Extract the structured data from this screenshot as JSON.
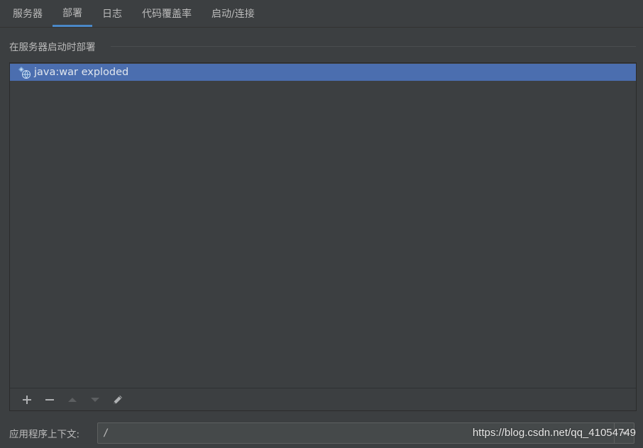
{
  "tabs": [
    {
      "label": "服务器",
      "active": false
    },
    {
      "label": "部署",
      "active": true
    },
    {
      "label": "日志",
      "active": false
    },
    {
      "label": "代码覆盖率",
      "active": false
    },
    {
      "label": "启动/连接",
      "active": false
    }
  ],
  "deploy_section": {
    "title": "在服务器启动时部署",
    "items": [
      {
        "label": "java:war exploded",
        "icon": "artifact-war-icon",
        "selected": true
      }
    ],
    "toolbar": {
      "add": "add-icon",
      "remove": "remove-icon",
      "move_up": "arrow-up-icon",
      "move_down": "arrow-down-icon",
      "edit": "pencil-icon"
    }
  },
  "context": {
    "label": "应用程序上下文:",
    "value": "/"
  },
  "watermark": "https://blog.csdn.net/qq_41054749",
  "colors": {
    "background": "#3c3f41",
    "selection": "#4b6eaf",
    "active_tab_underline": "#4a88c7",
    "text": "#bbbbbb"
  }
}
